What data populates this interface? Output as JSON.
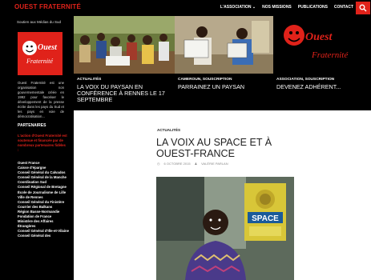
{
  "site": {
    "title": "OUEST FRATERNITÉ",
    "tagline": "Soutien aux Médias du Sud"
  },
  "nav": {
    "items": [
      {
        "label": "L'ASSOCIATION ⌄"
      },
      {
        "label": "NOS MISSIONS"
      },
      {
        "label": "PUBLICATIONS"
      },
      {
        "label": "CONTACT"
      }
    ],
    "search_icon": "search-icon"
  },
  "sidebar": {
    "about": "Ouest Fraternité est une organisation non gouvernementale créée en 1992 pour favoriser le développement de la presse écrite dans les pays du Sud et les pays en voie de démocratisation...",
    "partners_title": "PARTENAIRES",
    "partners_note": "L'action d'Ouest Fraternité est soutenue et financée par de nombreux partenaires fidèles :",
    "partners": [
      "Ouest France",
      "Caisse d'épargne",
      "Conseil Général du Calvados",
      "Conseil Général de la Manche",
      "Coordination Sud",
      "Conseil Régional de Bretagne",
      "École de Journalisme de Lille",
      "Ville de Rennes",
      "Conseil Général du Finistère",
      "Courrier des Balkans",
      "Région Basse-Normandie",
      "Fondation de France",
      "Ministère des Affaires Étrangères",
      "Conseil Général d'Ille-et-Vilaine",
      "Conseil Général des"
    ]
  },
  "featured": [
    {
      "category": "ACTUALITÉS",
      "title": "LA VOIX DU PAYSAN EN CONFÉRENCE À RENNES LE 17 SEPTEMBRE"
    },
    {
      "category": "CAMEROUN, SOUSCRIPTION",
      "title": "PARRAINEZ UN PAYSAN"
    },
    {
      "category": "ASSOCIATION, SOUSCRIPTION",
      "title": "DEVENEZ ADHÉRENT..."
    }
  ],
  "logo": {
    "word1": "Ouest",
    "word2": "Fraternité"
  },
  "article": {
    "category": "ACTUALITÉS",
    "title": "LA VOIX AU SPACE ET À OUEST-FRANCE",
    "date": "6 OCTOBRE 2015",
    "author": "VALÉRIE PARLAN",
    "photo_sign": "SPACE"
  },
  "colors": {
    "brand_red": "#e0221a",
    "background": "#000000"
  }
}
